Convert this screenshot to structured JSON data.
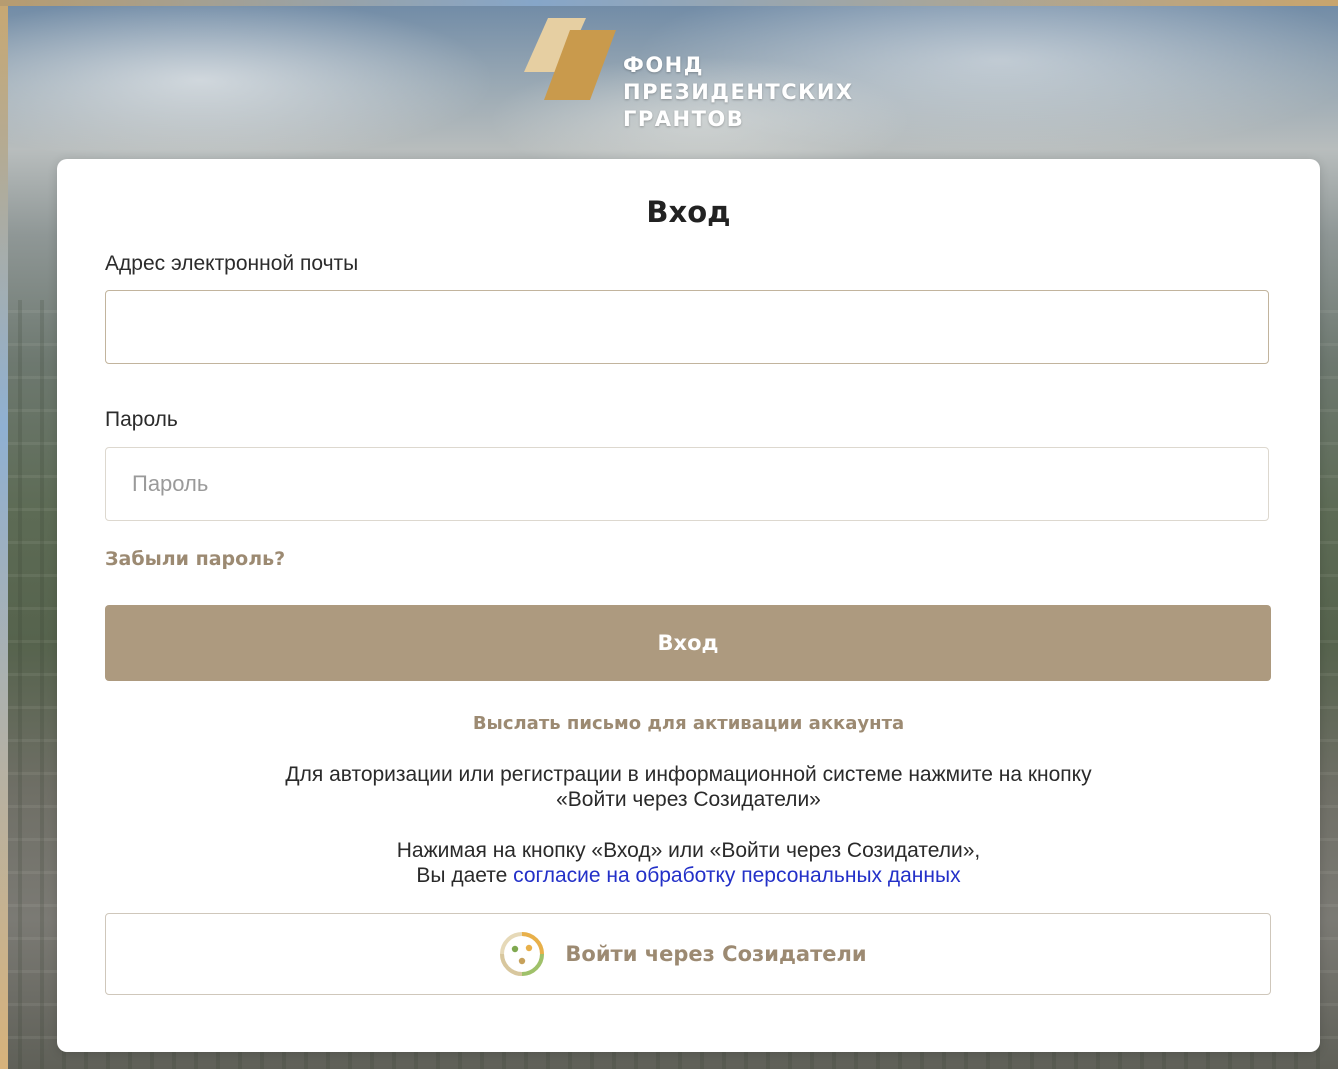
{
  "logo": {
    "line1": "ФОНД",
    "line2": "ПРЕЗИДЕНТСКИХ",
    "line3": "ГРАНТОВ",
    "colors": {
      "mark_light": "#e2c99a",
      "mark_dark": "#c99a4c"
    }
  },
  "login": {
    "title": "Вход",
    "email_label": "Адрес электронной почты",
    "email_value": "",
    "email_placeholder": "",
    "password_label": "Пароль",
    "password_value": "",
    "password_placeholder": "Пароль",
    "forgot_link": "Забыли пароль?",
    "submit_label": "Вход",
    "activation_link": "Выслать письмо для активации аккаунта",
    "info1_line1": "Для авторизации или регистрации в информационной системе нажмите на кнопку",
    "info1_line2": "«Войти через Созидатели»",
    "info2_line1": "Нажимая на кнопку «Вход» или «Войти через Созидатели»,",
    "info2_prefix": "Вы даете ",
    "consent_link": "согласие на обработку персональных данных",
    "sozidateli_button": "Войти через Созидатели"
  },
  "colors": {
    "accent": "#ad9a7f",
    "link_accent": "#9c8a72",
    "consent_link": "#2330c8"
  }
}
